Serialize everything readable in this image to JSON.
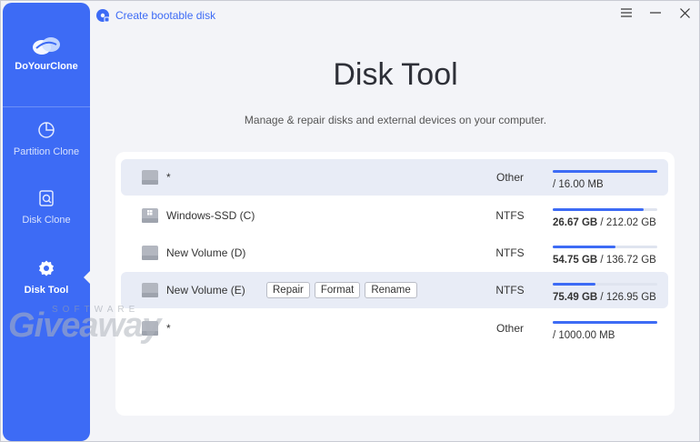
{
  "app": {
    "name": "DoYourClone",
    "titlebar_text": "Create bootable disk"
  },
  "sidebar": {
    "items": [
      {
        "label": "Partition Clone",
        "icon": "pie-chart-icon",
        "active": false
      },
      {
        "label": "Disk Clone",
        "icon": "disk-clone-icon",
        "active": false
      },
      {
        "label": "Disk Tool",
        "icon": "gear-icon",
        "active": true
      }
    ]
  },
  "window_controls": [
    "menu-icon",
    "minimize-icon",
    "close-icon"
  ],
  "main": {
    "title": "Disk Tool",
    "subtitle": "Manage & repair disks and external devices on your computer."
  },
  "disks": [
    {
      "name": "*",
      "fs": "Other",
      "used": "",
      "total": "16.00 MB",
      "fill": 1.0,
      "highlight": true
    },
    {
      "name": "Windows-SSD (C)",
      "fs": "NTFS",
      "used": "26.67 GB",
      "total": "212.02 GB",
      "fill": 0.87,
      "highlight": false
    },
    {
      "name": "New Volume (D)",
      "fs": "NTFS",
      "used": "54.75 GB",
      "total": "136.72 GB",
      "fill": 0.6,
      "highlight": false
    },
    {
      "name": "New Volume (E)",
      "fs": "NTFS",
      "used": "75.49 GB",
      "total": "126.95 GB",
      "fill": 0.41,
      "highlight": true,
      "actions": [
        "Repair",
        "Format",
        "Rename"
      ]
    },
    {
      "name": "*",
      "fs": "Other",
      "used": "",
      "total": "1000.00 MB",
      "fill": 1.0,
      "highlight": false
    }
  ],
  "watermark": {
    "small": "SOFTWARE",
    "big": "Giveaway"
  },
  "colors": {
    "accent": "#3d6bf5",
    "background": "#f3f4f8"
  }
}
